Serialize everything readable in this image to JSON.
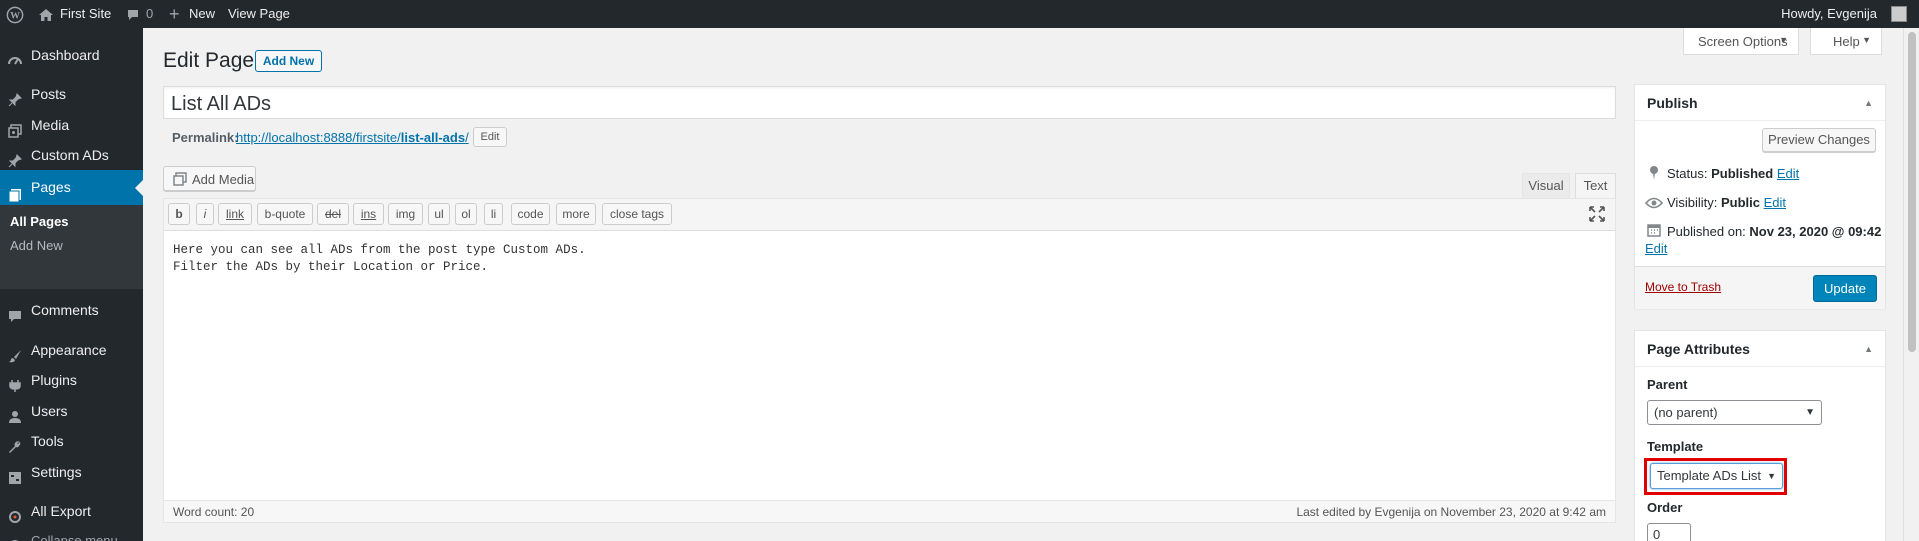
{
  "adminbar": {
    "site_name": "First Site",
    "comments_count": "0",
    "new_label": "New",
    "view_page": "View Page",
    "howdy": "Howdy, Evgenija"
  },
  "sidebar": {
    "items": [
      {
        "label": "Dashboard",
        "icon": "dashboard-icon"
      },
      {
        "label": "Posts",
        "icon": "pin-icon"
      },
      {
        "label": "Media",
        "icon": "media-icon"
      },
      {
        "label": "Custom ADs",
        "icon": "pin-icon"
      },
      {
        "label": "Pages",
        "icon": "page-icon"
      },
      {
        "label": "Comments",
        "icon": "comment-icon"
      },
      {
        "label": "Appearance",
        "icon": "brush-icon"
      },
      {
        "label": "Plugins",
        "icon": "plug-icon"
      },
      {
        "label": "Users",
        "icon": "user-icon"
      },
      {
        "label": "Tools",
        "icon": "wrench-icon"
      },
      {
        "label": "Settings",
        "icon": "settings-icon"
      },
      {
        "label": "All Export",
        "icon": "export-icon"
      },
      {
        "label": "Collapse menu",
        "icon": "collapse-icon"
      }
    ],
    "submenu": [
      "All Pages",
      "Add New"
    ]
  },
  "screen_options": "Screen Options",
  "help": "Help",
  "heading": "Edit Page",
  "add_new": "Add New",
  "post_title": "List All ADs",
  "permalink": {
    "label": "Permalink:",
    "url_base": "http://localhost:8888/firstsite/",
    "url_slug": "list-all-ads",
    "url_end": "/",
    "edit": "Edit"
  },
  "add_media": "Add Media",
  "editor_tabs": [
    "Visual",
    "Text"
  ],
  "quicktags": [
    "b",
    "i",
    "link",
    "b-quote",
    "del",
    "ins",
    "img",
    "ul",
    "ol",
    "li",
    "code",
    "more",
    "close tags"
  ],
  "content_lines": [
    "Here you can see all ADs from the post type Custom ADs.",
    "Filter the ADs by their Location or Price."
  ],
  "word_count": "Word count: 20",
  "last_edited": "Last edited by Evgenija on November 23, 2020 at 9:42 am",
  "publish": {
    "title": "Publish",
    "preview": "Preview Changes",
    "status_label": "Status:",
    "status_value": "Published",
    "visibility_label": "Visibility:",
    "visibility_value": "Public",
    "published_label": "Published on:",
    "published_value": "Nov 23, 2020 @ 09:42",
    "edit": "Edit",
    "trash": "Move to Trash",
    "update": "Update"
  },
  "attributes": {
    "title": "Page Attributes",
    "parent_label": "Parent",
    "parent_value": "(no parent)",
    "template_label": "Template",
    "template_value": "Template ADs List",
    "order_label": "Order",
    "order_value": "0"
  },
  "colors": {
    "admin_dark": "#23282d",
    "accent": "#0073aa",
    "highlight": "#e00000",
    "trash": "#a00000"
  }
}
